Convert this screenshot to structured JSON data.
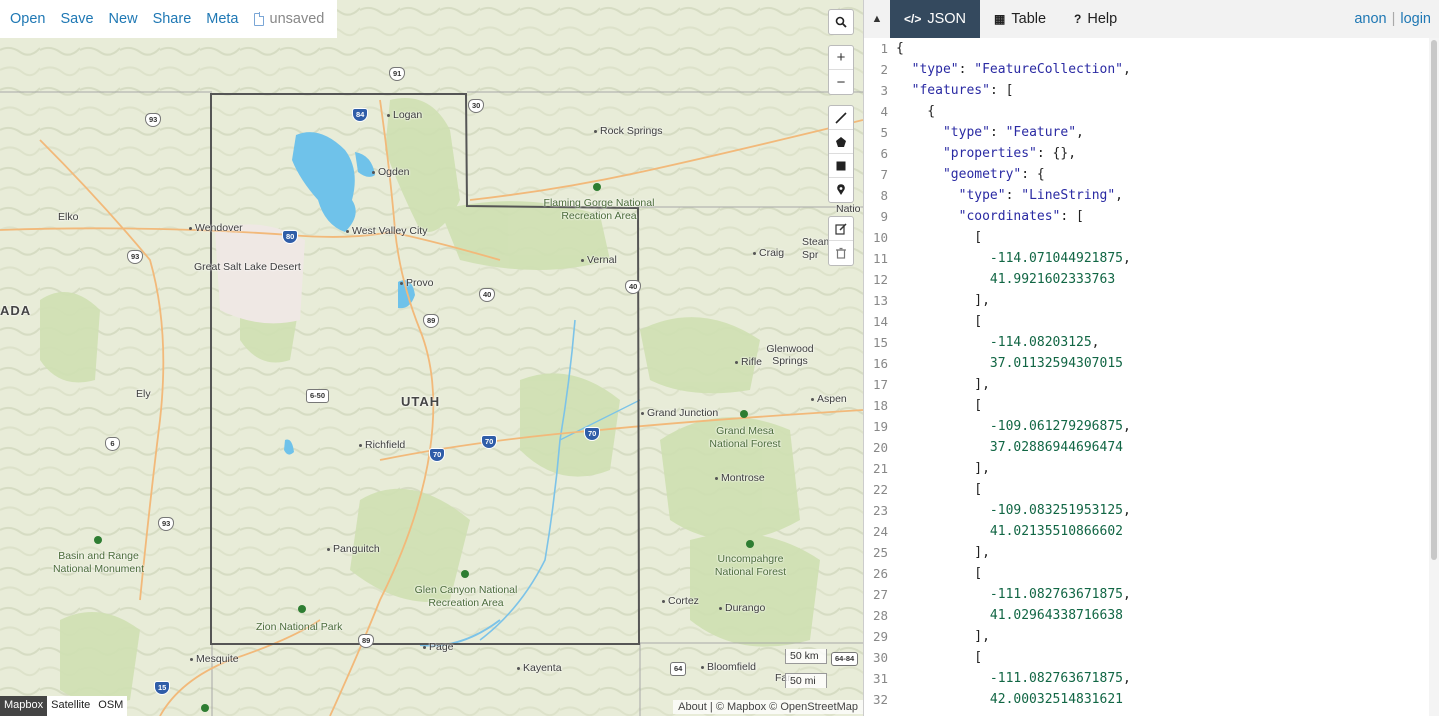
{
  "toolbar": {
    "open": "Open",
    "save": "Save",
    "new": "New",
    "share": "Share",
    "meta": "Meta",
    "unsaved": "unsaved"
  },
  "map_controls": {
    "search_icon": "search-icon",
    "zoom_in": "+",
    "zoom_out": "−",
    "draw_tools": [
      "line-icon",
      "polygon-icon",
      "rectangle-icon",
      "marker-icon"
    ],
    "edit_tools": [
      "edit-icon",
      "trash-icon"
    ]
  },
  "layers": {
    "items": [
      "Mapbox",
      "Satellite",
      "OSM"
    ],
    "active": "Mapbox"
  },
  "scale": {
    "km": "50 km",
    "mi": "50 mi"
  },
  "attribution": "About | © Mapbox © OpenStreetMap",
  "map_labels": {
    "utah": "UTAH",
    "nevada": "ADA",
    "logan": "Logan",
    "ogden": "Ogden",
    "rock_springs": "Rock Springs",
    "flaming_gorge": "Flaming Gorge National Recreation Area",
    "nati": "Natio",
    "elko": "Elko",
    "wendover": "Wendover",
    "west_valley": "West Valley City",
    "great_salt_lake_desert": "Great Salt Lake Desert",
    "vernal": "Vernal",
    "craig": "Craig",
    "steamboat": "Steam Spr",
    "provo": "Provo",
    "glenwood": "Glenwood Springs",
    "rifle": "Rifle",
    "ely": "Ely",
    "grand_junction": "Grand Junction",
    "aspen": "Aspen",
    "grand_mesa": "Grand Mesa National Forest",
    "richfield": "Richfield",
    "montrose": "Montrose",
    "basin_range": "Basin and Range National Monument",
    "panguitch": "Panguitch",
    "uncompahgre": "Uncompahgre National Forest",
    "glen_canyon": "Glen Canyon National Recreation Area",
    "cortez": "Cortez",
    "durango": "Durango",
    "zion": "Zion National Park",
    "mesquite": "Mesquite",
    "page": "Page",
    "kayenta": "Kayenta",
    "bloomfield": "Bloomfield",
    "farmington": "Far"
  },
  "shields": [
    "84",
    "91",
    "30",
    "93",
    "80",
    "93",
    "40",
    "89",
    "40",
    "6-50",
    "6",
    "70",
    "70",
    "70",
    "93",
    "89",
    "15",
    "64",
    "64-84"
  ],
  "pane": {
    "tabs": [
      {
        "icon": "</>",
        "label": "JSON",
        "active": true
      },
      {
        "icon": "▦",
        "label": "Table",
        "active": false
      },
      {
        "icon": "?",
        "label": "Help",
        "active": false
      }
    ],
    "anon": "anon",
    "login": "login"
  },
  "json_lines": [
    "{",
    "  \"type\": \"FeatureCollection\",",
    "  \"features\": [",
    "    {",
    "      \"type\": \"Feature\",",
    "      \"properties\": {},",
    "      \"geometry\": {",
    "        \"type\": \"LineString\",",
    "        \"coordinates\": [",
    "          [",
    "            -114.071044921875,",
    "            41.9921602333763",
    "          ],",
    "          [",
    "            -114.08203125,",
    "            37.01132594307015",
    "          ],",
    "          [",
    "            -109.061279296875,",
    "            37.02886944696474",
    "          ],",
    "          [",
    "            -109.083251953125,",
    "            41.02135510866602",
    "          ],",
    "          [",
    "            -111.082763671875,",
    "            41.02964338716638",
    "          ],",
    "          [",
    "            -111.082763671875,",
    "            42.00032514831621"
  ]
}
